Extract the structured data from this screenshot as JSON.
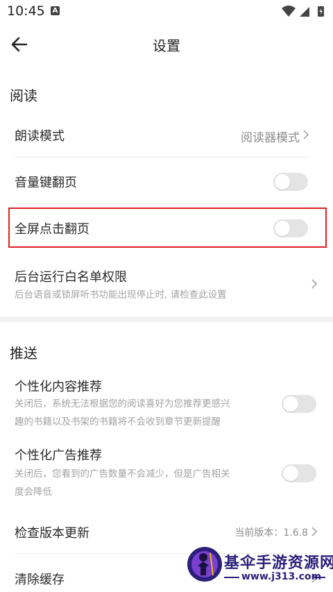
{
  "status_bar": {
    "time": "10:45",
    "notification_badge": "A"
  },
  "header": {
    "title": "设置",
    "back_icon": "arrow-left-icon"
  },
  "sections": {
    "reading": {
      "title": "阅读",
      "read_aloud_mode": {
        "label": "朗读模式",
        "value": "阅读器模式"
      },
      "volume_key_page_turn": {
        "label": "音量键翻页",
        "enabled": false
      },
      "fullscreen_tap_page_turn": {
        "label": "全屏点击翻页",
        "enabled": false
      },
      "background_whitelist": {
        "label": "后台运行白名单权限",
        "description": "后台语音或锁屏听书功能出现停止时, 请检查此设置"
      }
    },
    "push": {
      "title": "推送",
      "personalized_content": {
        "label": "个性化内容推荐",
        "description_line1": "关闭后，系统无法根据您的阅读喜好为您推荐更感兴",
        "description_line2": "趣的书籍以及书架的书籍将不会收到章节更新提醒",
        "enabled": false
      },
      "personalized_ads": {
        "label": "个性化广告推荐",
        "description_line1": "关闭后，您看到的广告数量不会减少，但是广告相关",
        "description_line2": "度会降低",
        "enabled": false
      }
    },
    "misc": {
      "check_update": {
        "label": "检查版本更新",
        "value": "当前版本：1.6.8"
      },
      "clear_cache": {
        "label": "清除缓存"
      }
    }
  },
  "watermark": {
    "text": "基伞手游资源网",
    "url": "www.j313.com"
  },
  "colors": {
    "highlight_border": "#e02020",
    "toggle_off": "#e4e4e4",
    "watermark": "#2b1f7a"
  }
}
